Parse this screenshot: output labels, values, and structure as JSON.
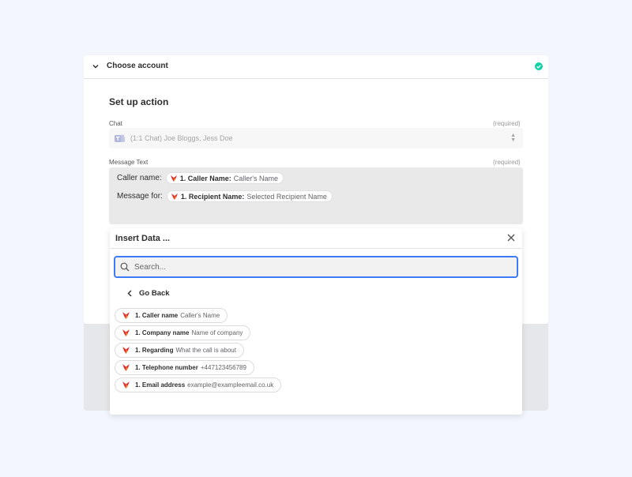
{
  "account": {
    "header_title": "Choose account",
    "status_color": "#13d0a7"
  },
  "action": {
    "title": "Set up action",
    "chat": {
      "label": "Chat",
      "required": "(required)",
      "value": "(1:1 Chat) Joe Bloggs, Jess Doe"
    },
    "message": {
      "label": "Message Text",
      "required": "(required)",
      "lines": [
        {
          "label": "Caller name:",
          "token_key": "1. Caller Name:",
          "token_value": "Caller's Name"
        },
        {
          "label": "Message for:",
          "token_key": "1. Recipient Name:",
          "token_value": "Selected Recipient Name"
        }
      ]
    }
  },
  "insert_data": {
    "title": "Insert Data ...",
    "search_placeholder": "Search...",
    "go_back": "Go Back",
    "items": [
      {
        "key": "1. Caller name",
        "value": "Caller's Name"
      },
      {
        "key": "1. Company name",
        "value": "Name of company"
      },
      {
        "key": "1. Regarding",
        "value": "What the call is about"
      },
      {
        "key": "1. Telephone number",
        "value": "+447123456789"
      },
      {
        "key": "1. Email address",
        "value": "example@exampleemail.co.uk"
      }
    ]
  },
  "colors": {
    "accent_blue": "#3d7bf6",
    "brand_red": "#e0302f"
  }
}
